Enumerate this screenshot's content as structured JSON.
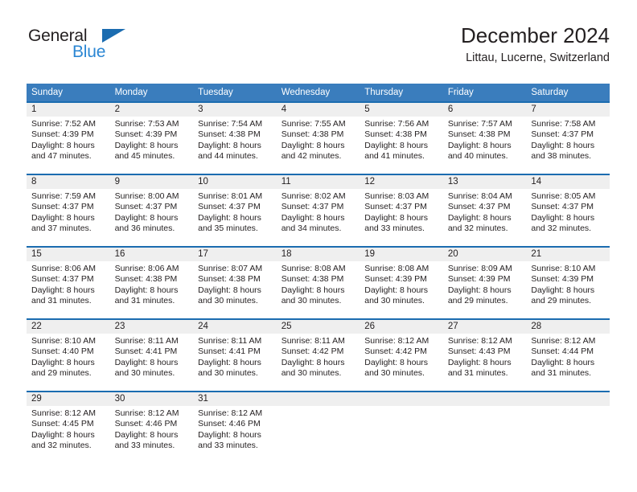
{
  "logo": {
    "word_one": "General",
    "word_two": "Blue",
    "triangle_color": "#1b6cb0",
    "blue_color": "#2a86d3",
    "dark_color": "#231f20"
  },
  "header": {
    "title": "December 2024",
    "location": "Littau, Lucerne, Switzerland"
  },
  "theme": {
    "header_row_bg": "#3a7dbd",
    "row_top_border": "#1b6cb0",
    "daynum_band_bg": "#efefef",
    "text_color": "#231f20"
  },
  "weekdays": [
    "Sunday",
    "Monday",
    "Tuesday",
    "Wednesday",
    "Thursday",
    "Friday",
    "Saturday"
  ],
  "weeks": [
    [
      {
        "day": "1",
        "sunrise": "Sunrise: 7:52 AM",
        "sunset": "Sunset: 4:39 PM",
        "daylight_1": "Daylight: 8 hours",
        "daylight_2": "and 47 minutes."
      },
      {
        "day": "2",
        "sunrise": "Sunrise: 7:53 AM",
        "sunset": "Sunset: 4:39 PM",
        "daylight_1": "Daylight: 8 hours",
        "daylight_2": "and 45 minutes."
      },
      {
        "day": "3",
        "sunrise": "Sunrise: 7:54 AM",
        "sunset": "Sunset: 4:38 PM",
        "daylight_1": "Daylight: 8 hours",
        "daylight_2": "and 44 minutes."
      },
      {
        "day": "4",
        "sunrise": "Sunrise: 7:55 AM",
        "sunset": "Sunset: 4:38 PM",
        "daylight_1": "Daylight: 8 hours",
        "daylight_2": "and 42 minutes."
      },
      {
        "day": "5",
        "sunrise": "Sunrise: 7:56 AM",
        "sunset": "Sunset: 4:38 PM",
        "daylight_1": "Daylight: 8 hours",
        "daylight_2": "and 41 minutes."
      },
      {
        "day": "6",
        "sunrise": "Sunrise: 7:57 AM",
        "sunset": "Sunset: 4:38 PM",
        "daylight_1": "Daylight: 8 hours",
        "daylight_2": "and 40 minutes."
      },
      {
        "day": "7",
        "sunrise": "Sunrise: 7:58 AM",
        "sunset": "Sunset: 4:37 PM",
        "daylight_1": "Daylight: 8 hours",
        "daylight_2": "and 38 minutes."
      }
    ],
    [
      {
        "day": "8",
        "sunrise": "Sunrise: 7:59 AM",
        "sunset": "Sunset: 4:37 PM",
        "daylight_1": "Daylight: 8 hours",
        "daylight_2": "and 37 minutes."
      },
      {
        "day": "9",
        "sunrise": "Sunrise: 8:00 AM",
        "sunset": "Sunset: 4:37 PM",
        "daylight_1": "Daylight: 8 hours",
        "daylight_2": "and 36 minutes."
      },
      {
        "day": "10",
        "sunrise": "Sunrise: 8:01 AM",
        "sunset": "Sunset: 4:37 PM",
        "daylight_1": "Daylight: 8 hours",
        "daylight_2": "and 35 minutes."
      },
      {
        "day": "11",
        "sunrise": "Sunrise: 8:02 AM",
        "sunset": "Sunset: 4:37 PM",
        "daylight_1": "Daylight: 8 hours",
        "daylight_2": "and 34 minutes."
      },
      {
        "day": "12",
        "sunrise": "Sunrise: 8:03 AM",
        "sunset": "Sunset: 4:37 PM",
        "daylight_1": "Daylight: 8 hours",
        "daylight_2": "and 33 minutes."
      },
      {
        "day": "13",
        "sunrise": "Sunrise: 8:04 AM",
        "sunset": "Sunset: 4:37 PM",
        "daylight_1": "Daylight: 8 hours",
        "daylight_2": "and 32 minutes."
      },
      {
        "day": "14",
        "sunrise": "Sunrise: 8:05 AM",
        "sunset": "Sunset: 4:37 PM",
        "daylight_1": "Daylight: 8 hours",
        "daylight_2": "and 32 minutes."
      }
    ],
    [
      {
        "day": "15",
        "sunrise": "Sunrise: 8:06 AM",
        "sunset": "Sunset: 4:37 PM",
        "daylight_1": "Daylight: 8 hours",
        "daylight_2": "and 31 minutes."
      },
      {
        "day": "16",
        "sunrise": "Sunrise: 8:06 AM",
        "sunset": "Sunset: 4:38 PM",
        "daylight_1": "Daylight: 8 hours",
        "daylight_2": "and 31 minutes."
      },
      {
        "day": "17",
        "sunrise": "Sunrise: 8:07 AM",
        "sunset": "Sunset: 4:38 PM",
        "daylight_1": "Daylight: 8 hours",
        "daylight_2": "and 30 minutes."
      },
      {
        "day": "18",
        "sunrise": "Sunrise: 8:08 AM",
        "sunset": "Sunset: 4:38 PM",
        "daylight_1": "Daylight: 8 hours",
        "daylight_2": "and 30 minutes."
      },
      {
        "day": "19",
        "sunrise": "Sunrise: 8:08 AM",
        "sunset": "Sunset: 4:39 PM",
        "daylight_1": "Daylight: 8 hours",
        "daylight_2": "and 30 minutes."
      },
      {
        "day": "20",
        "sunrise": "Sunrise: 8:09 AM",
        "sunset": "Sunset: 4:39 PM",
        "daylight_1": "Daylight: 8 hours",
        "daylight_2": "and 29 minutes."
      },
      {
        "day": "21",
        "sunrise": "Sunrise: 8:10 AM",
        "sunset": "Sunset: 4:39 PM",
        "daylight_1": "Daylight: 8 hours",
        "daylight_2": "and 29 minutes."
      }
    ],
    [
      {
        "day": "22",
        "sunrise": "Sunrise: 8:10 AM",
        "sunset": "Sunset: 4:40 PM",
        "daylight_1": "Daylight: 8 hours",
        "daylight_2": "and 29 minutes."
      },
      {
        "day": "23",
        "sunrise": "Sunrise: 8:11 AM",
        "sunset": "Sunset: 4:41 PM",
        "daylight_1": "Daylight: 8 hours",
        "daylight_2": "and 30 minutes."
      },
      {
        "day": "24",
        "sunrise": "Sunrise: 8:11 AM",
        "sunset": "Sunset: 4:41 PM",
        "daylight_1": "Daylight: 8 hours",
        "daylight_2": "and 30 minutes."
      },
      {
        "day": "25",
        "sunrise": "Sunrise: 8:11 AM",
        "sunset": "Sunset: 4:42 PM",
        "daylight_1": "Daylight: 8 hours",
        "daylight_2": "and 30 minutes."
      },
      {
        "day": "26",
        "sunrise": "Sunrise: 8:12 AM",
        "sunset": "Sunset: 4:42 PM",
        "daylight_1": "Daylight: 8 hours",
        "daylight_2": "and 30 minutes."
      },
      {
        "day": "27",
        "sunrise": "Sunrise: 8:12 AM",
        "sunset": "Sunset: 4:43 PM",
        "daylight_1": "Daylight: 8 hours",
        "daylight_2": "and 31 minutes."
      },
      {
        "day": "28",
        "sunrise": "Sunrise: 8:12 AM",
        "sunset": "Sunset: 4:44 PM",
        "daylight_1": "Daylight: 8 hours",
        "daylight_2": "and 31 minutes."
      }
    ],
    [
      {
        "day": "29",
        "sunrise": "Sunrise: 8:12 AM",
        "sunset": "Sunset: 4:45 PM",
        "daylight_1": "Daylight: 8 hours",
        "daylight_2": "and 32 minutes."
      },
      {
        "day": "30",
        "sunrise": "Sunrise: 8:12 AM",
        "sunset": "Sunset: 4:46 PM",
        "daylight_1": "Daylight: 8 hours",
        "daylight_2": "and 33 minutes."
      },
      {
        "day": "31",
        "sunrise": "Sunrise: 8:12 AM",
        "sunset": "Sunset: 4:46 PM",
        "daylight_1": "Daylight: 8 hours",
        "daylight_2": "and 33 minutes."
      },
      {
        "day": "",
        "sunrise": "",
        "sunset": "",
        "daylight_1": "",
        "daylight_2": ""
      },
      {
        "day": "",
        "sunrise": "",
        "sunset": "",
        "daylight_1": "",
        "daylight_2": ""
      },
      {
        "day": "",
        "sunrise": "",
        "sunset": "",
        "daylight_1": "",
        "daylight_2": ""
      },
      {
        "day": "",
        "sunrise": "",
        "sunset": "",
        "daylight_1": "",
        "daylight_2": ""
      }
    ]
  ]
}
